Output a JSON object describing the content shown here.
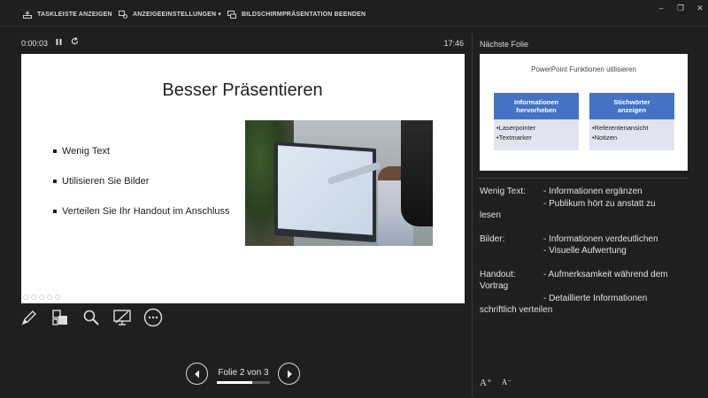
{
  "toolbar": {
    "taskbar_label": "TASKLEISTE ANZEIGEN",
    "display_settings_label": "ANZEIGEEINSTELLUNGEN ▾",
    "end_show_label": "BILDSCHIRMPRÄSENTATION BEENDEN",
    "minimize": "–",
    "restore": "❐",
    "close": "✕"
  },
  "timer": {
    "elapsed": "0:00:03",
    "pause_icon": "pause-icon",
    "restart_icon": "restart-icon",
    "clock": "17:46"
  },
  "slide": {
    "title": "Besser Präsentieren",
    "bullets": [
      "Wenig Text",
      "Utilisieren Sie Bilder",
      "Verteilen Sie Ihr Handout im Anschluss"
    ]
  },
  "tools": [
    "pen-icon",
    "all-slides-icon",
    "zoom-icon",
    "screen-toggle-icon",
    "more-options-icon"
  ],
  "navigation": {
    "label": "Folie 2 von 3",
    "progress": 0.6667
  },
  "next_slide": {
    "heading": "Nächste Folie",
    "title": "PowerPoint Funktionen utilisieren",
    "boxes": [
      {
        "head_line1": "Informationen",
        "head_line2": "hervorheben",
        "items": [
          "•Laserpointer",
          "•Textmarker"
        ]
      },
      {
        "head_line1": "Stichwörter",
        "head_line2": "anzeigen",
        "items": [
          "•Referentenansicht",
          "•Notizen"
        ]
      }
    ]
  },
  "notes": {
    "wenig_label": "Wenig Text:",
    "wenig_1": "- Informationen ergänzen",
    "wenig_2": "- Publikum hört zu anstatt zu",
    "wenig_3": "lesen",
    "bilder_label": "Bilder:",
    "bilder_1": "- Informationen verdeutlichen",
    "bilder_2": "- Visuelle Aufwertung",
    "handout_label": "Handout:",
    "handout_1": "- Aufmerksamkeit während dem",
    "handout_2": "Vortrag",
    "handout_3": "- Detaillierte Informationen",
    "handout_4": "schriftlich verteilen"
  },
  "font_controls": {
    "increase": "A⁺",
    "decrease": "A⁻"
  },
  "colors": {
    "background": "#1f1f1f",
    "accent_blue": "#4472c4",
    "box_light": "#dfe4ee"
  }
}
